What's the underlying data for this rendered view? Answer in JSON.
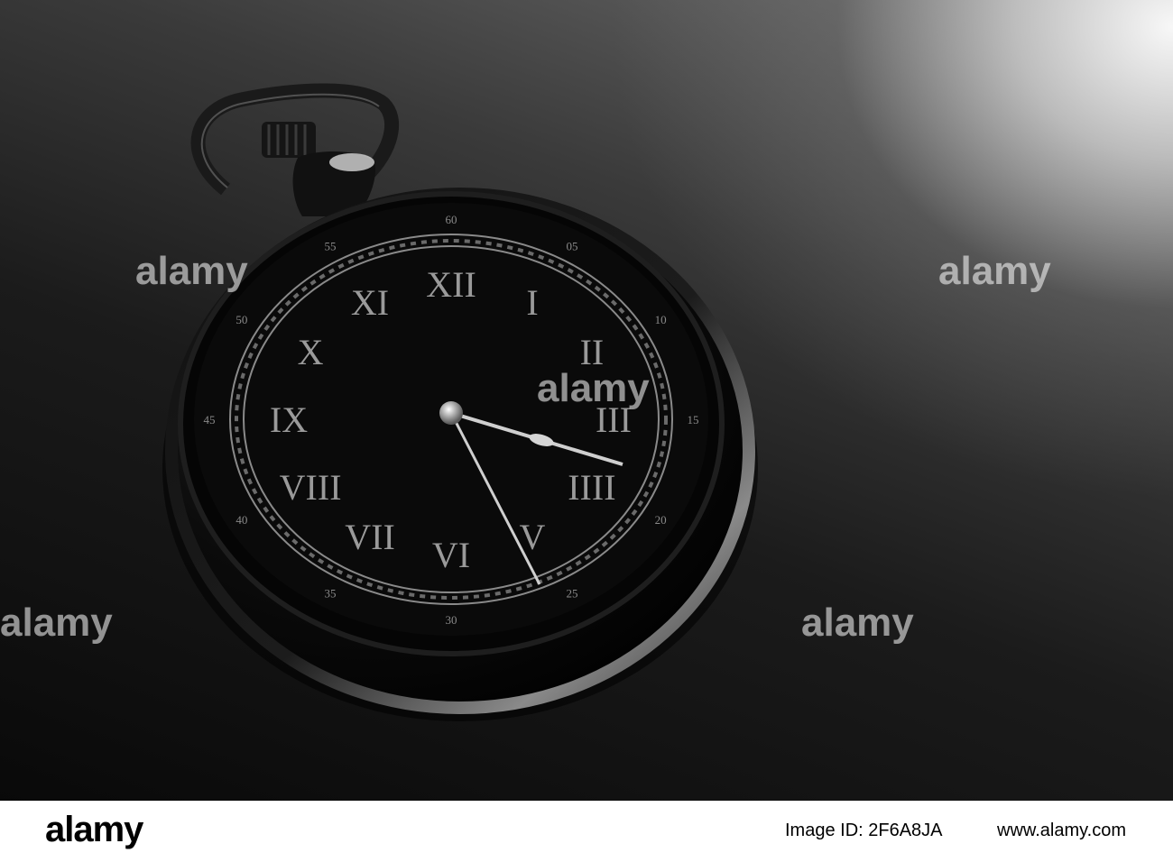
{
  "photo": {
    "subject": "black pocket watch on dark reflective surface",
    "dial": {
      "roman_numerals": [
        "I",
        "II",
        "III",
        "IIII",
        "V",
        "VI",
        "VII",
        "VIII",
        "IX",
        "X",
        "XI",
        "XII"
      ],
      "minute_labels": [
        "05",
        "10",
        "15",
        "20",
        "25",
        "30",
        "35",
        "40",
        "45",
        "50",
        "55",
        "60"
      ],
      "hour_hand_position": 3.8,
      "minute_hand_position": 27.5
    },
    "watermark_text": "alamy",
    "colors": {
      "background_dark": "#070707",
      "highlight": "#ffffff",
      "dial_metal": "#bdbdbd"
    }
  },
  "banner": {
    "logo": "alamy",
    "image_id": "Image ID: 2F6A8JA",
    "site": "www.alamy.com"
  }
}
